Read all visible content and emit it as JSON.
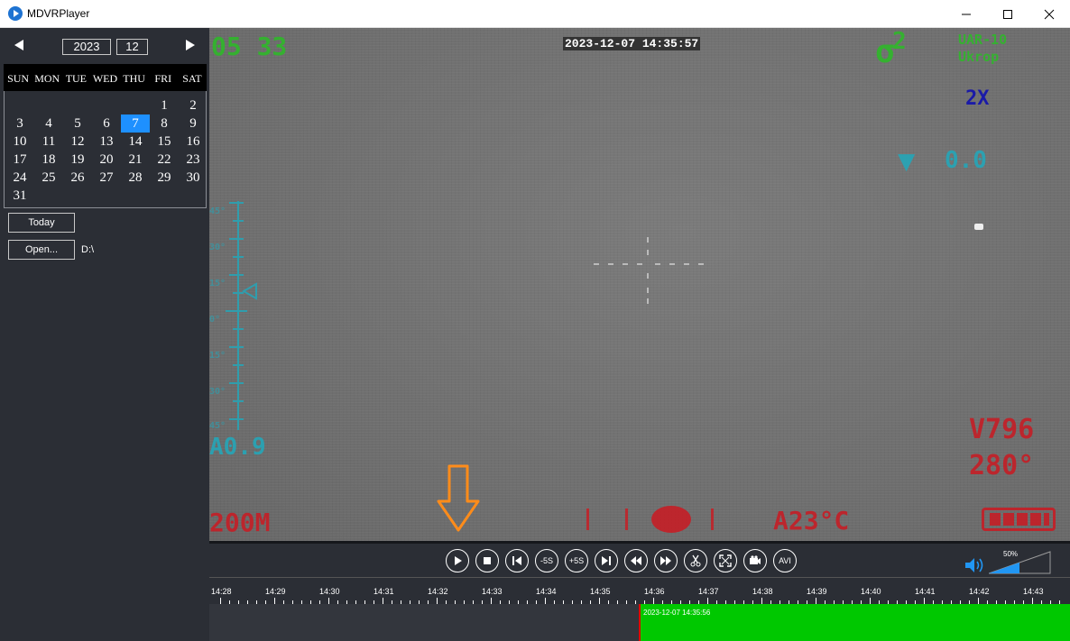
{
  "window": {
    "title": "MDVRPlayer",
    "icons": [
      "app-logo",
      "minimize-icon",
      "maximize-icon",
      "close-icon"
    ]
  },
  "calendar": {
    "year": "2023",
    "month": "12",
    "weekdays": [
      "SUN",
      "MON",
      "TUE",
      "WED",
      "THU",
      "FRI",
      "SAT"
    ],
    "days": [
      "1",
      "2",
      "3",
      "4",
      "5",
      "6",
      "7",
      "8",
      "9",
      "10",
      "11",
      "12",
      "13",
      "14",
      "15",
      "16",
      "17",
      "18",
      "19",
      "20",
      "21",
      "22",
      "23",
      "24",
      "25",
      "26",
      "27",
      "28",
      "29",
      "30",
      "31"
    ],
    "first_weekday_index": 5,
    "selected_day": "7",
    "today_label": "Today",
    "open_label": "Open...",
    "path": "D:\\"
  },
  "video": {
    "timestamp": "2023-12-07 14:35:57",
    "top_left": "05 33",
    "top_right_symbol": "σ",
    "top_right_num": "2",
    "callsign_1": "UAR-10",
    "callsign_2": "Ukrop",
    "zoom": "2X",
    "tilt": "0.0",
    "scale_labels": [
      "45°",
      "30°",
      "15°",
      "0°",
      "15°",
      "30°",
      "45°"
    ],
    "left_value": "A0.9",
    "voltage": "V796",
    "heading": "280°",
    "range": "200M",
    "temperature": "A23°C",
    "colors": {
      "green": "#2fb82a",
      "cyan": "#25a6b8",
      "red": "#c51e26"
    }
  },
  "controls": {
    "buttons": [
      "play",
      "stop",
      "prev",
      "-5S",
      "+5S",
      "next",
      "rewind",
      "fast-forward",
      "cut",
      "fullscreen",
      "snapshot",
      "AVI"
    ],
    "minus5": "-5S",
    "plus5": "+5S",
    "avi": "AVI",
    "volume_pct": "50%",
    "volume_level": 0.5
  },
  "timeline": {
    "labels": [
      "14:28",
      "14:29",
      "14:30",
      "14:31",
      "14:32",
      "14:33",
      "14:34",
      "14:35",
      "14:36",
      "14:37",
      "14:38",
      "14:39",
      "14:40",
      "14:41",
      "14:42",
      "14:43"
    ],
    "recording_label": "2023-12-07 14:35:56",
    "recording_color": "#00c800"
  },
  "annotation": {
    "arrow_color": "#ff8c1a"
  }
}
